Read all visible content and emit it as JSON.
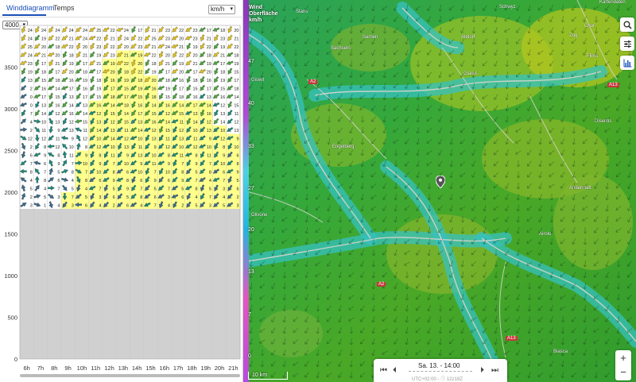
{
  "tabs": [
    {
      "label": "Winddiagramm",
      "active": true
    },
    {
      "label": "Temps",
      "active": false
    }
  ],
  "unit_select": {
    "value": "km/h"
  },
  "altitude_select": {
    "value": "4000"
  },
  "chart_data": {
    "type": "table",
    "hours": [
      "6h",
      "7h",
      "8h",
      "9h",
      "10h",
      "11h",
      "12h",
      "13h",
      "14h",
      "15h",
      "16h",
      "17h",
      "18h",
      "19h",
      "20h",
      "21h"
    ],
    "y_ticks": [
      0,
      500,
      1000,
      1500,
      2000,
      2500,
      3000,
      3500
    ],
    "ylim": [
      0,
      4000
    ],
    "terrain_altitude": 1800,
    "first_row_speeds": [
      24,
      24,
      24,
      24,
      24,
      25,
      22,
      24,
      17,
      21,
      23,
      22,
      23,
      17,
      18,
      20
    ],
    "first_col_speeds": [
      24,
      24,
      25,
      24,
      23,
      19,
      13,
      2,
      0,
      0,
      7,
      4,
      2,
      12,
      2
    ],
    "colors": {
      "high": "#e0c21a",
      "mid": "#4aa53a",
      "low": "#1f6a3a",
      "teal": "#1a8a7a",
      "thermal": "#ffff8c",
      "ground": "#d0d0d0"
    }
  },
  "map": {
    "title_line1": "Wind",
    "title_line2": "Oberfläche",
    "title_line3": "km/h",
    "scale_values": [
      "47",
      "40",
      "33",
      "27",
      "20",
      "13",
      "7",
      "0"
    ],
    "place_labels": [
      "Stans",
      "Sachseln",
      "Sarnen",
      "Giswil",
      "Engelberg",
      "Glarus",
      "Altdorf",
      "Andermatt",
      "Airolo",
      "Biasca",
      "Schwyz",
      "Zug",
      "Flims",
      "Disentis",
      "Olivone",
      "Chur"
    ],
    "road_labels": [
      "A2",
      "A2",
      "A13",
      "A13"
    ],
    "scalebar": "10 km",
    "time_label": "Sa. 13. - 14:00",
    "time_sub": "UTC+02:00 - ⓘ 12z18Z",
    "copyright": "Kartendaten",
    "buttons": [
      "search-icon",
      "settings-icon",
      "chart-icon"
    ],
    "zoom_in": "+",
    "zoom_out": "−"
  }
}
